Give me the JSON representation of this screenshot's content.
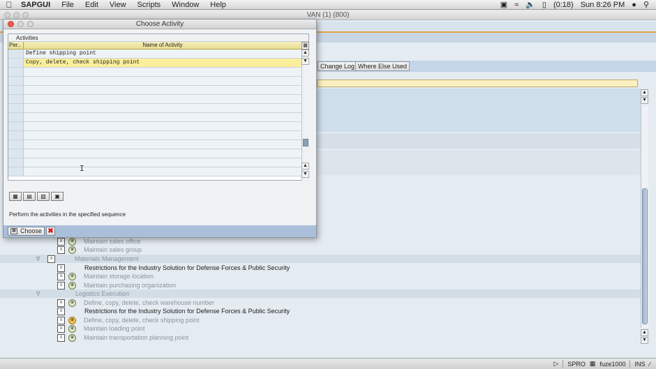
{
  "menubar": {
    "app": "SAPGUI",
    "items": [
      "File",
      "Edit",
      "View",
      "Scripts",
      "Window",
      "Help"
    ],
    "battery": "(0:18)",
    "clock": "Sun 8:26 PM"
  },
  "bg_window": {
    "title": "VAN (1) (800)",
    "toolbar": {
      "change_log": "Change Log",
      "where_used": "Where Else Used"
    },
    "tree": [
      {
        "label": "Maintain sales office"
      },
      {
        "label": "Maintain sales group"
      },
      {
        "label": "Materials Management"
      },
      {
        "label": "Restrictions for the Industry Solution for Defense Forces & Public Security"
      },
      {
        "label": "Maintain storage location"
      },
      {
        "label": "Maintain purchasing organization"
      },
      {
        "label": "Logistics Execution"
      },
      {
        "label": "Define, copy, delete, check warehouse number"
      },
      {
        "label": "Restrictions for the Industry Solution for Defense Forces & Public Security"
      },
      {
        "label": "Define, copy, delete, check shipping point"
      },
      {
        "label": "Maintain loading point"
      },
      {
        "label": "Maintain transportation planning point"
      }
    ]
  },
  "status": {
    "transaction": "SPRO",
    "server": "fuze1000",
    "mode": "INS"
  },
  "dialog": {
    "title": "Choose Activity",
    "caption": "Activities",
    "columns": {
      "per": "Per..",
      "name": "Name of Activity"
    },
    "rows": [
      {
        "name": "Define shipping point"
      },
      {
        "name": "Copy, delete, check shipping point"
      }
    ],
    "hint": "Perform the activities in the specified sequence",
    "choose_label": "Choose"
  }
}
